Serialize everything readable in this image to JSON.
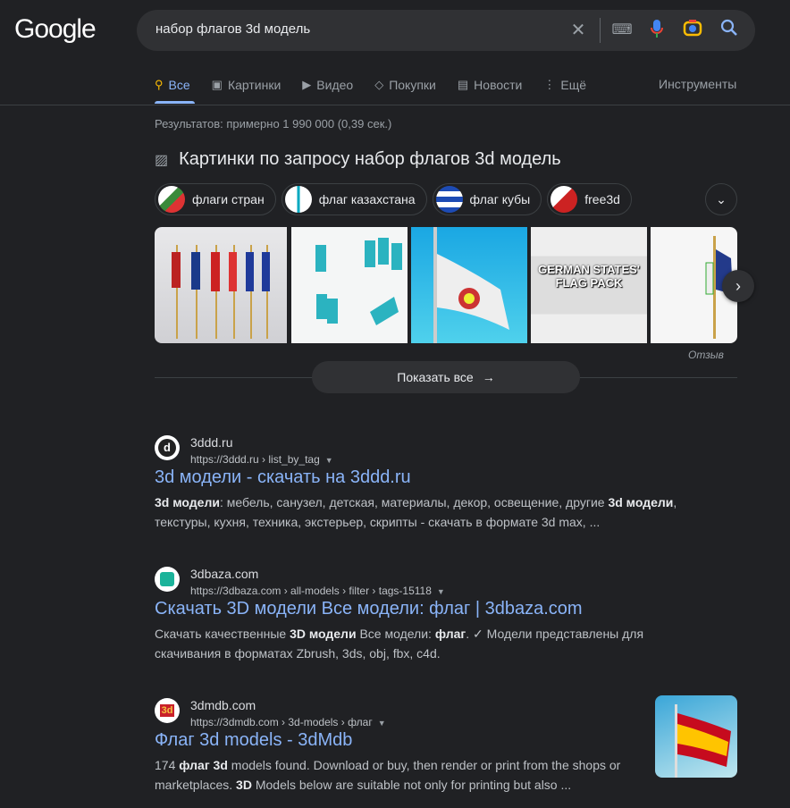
{
  "logo": "Google",
  "search": {
    "query": "набор флагов 3d модель"
  },
  "tabs": [
    {
      "label": "Все",
      "icon": "search-icon"
    },
    {
      "label": "Картинки",
      "icon": "image-icon"
    },
    {
      "label": "Видео",
      "icon": "play-icon"
    },
    {
      "label": "Покупки",
      "icon": "tag-icon"
    },
    {
      "label": "Новости",
      "icon": "news-icon"
    },
    {
      "label": "Ещё",
      "icon": "more-icon"
    }
  ],
  "tools_label": "Инструменты",
  "results_count": "Результатов: примерно 1 990 000 (0,39 сек.)",
  "images": {
    "heading": "Картинки по запросу набор флагов 3d модель",
    "chips": [
      "флаги стран",
      "флаг казахстана",
      "флаг кубы",
      "free3d"
    ],
    "pack_text": "GERMAN STATES' FLAG PACK",
    "feedback": "Отзыв",
    "show_all": "Показать все"
  },
  "results": [
    {
      "site": "3ddd.ru",
      "url": "https://3ddd.ru › list_by_tag",
      "title": "3d модели - скачать на 3ddd.ru",
      "snippet": [
        {
          "b": true,
          "t": "3d модели"
        },
        {
          "b": false,
          "t": ": мебель, санузел, детская, материалы, декор, освещение, другие "
        },
        {
          "b": true,
          "t": "3d модели"
        },
        {
          "b": false,
          "t": ", текстуры, кухня, техника, экстерьер, скрипты - скачать в формате 3d max, ..."
        }
      ]
    },
    {
      "site": "3dbaza.com",
      "url": "https://3dbaza.com › all-models › filter › tags-15118",
      "title": "Скачать 3D модели Все модели: флаг | 3dbaza.com",
      "snippet": [
        {
          "b": false,
          "t": "Скачать качественные "
        },
        {
          "b": true,
          "t": "3D модели"
        },
        {
          "b": false,
          "t": " Все модели: "
        },
        {
          "b": true,
          "t": "флаг"
        },
        {
          "b": false,
          "t": ". ✓ Модели представлены для скачивания в форматах Zbrush, 3ds, obj, fbx, c4d."
        }
      ]
    },
    {
      "site": "3dmdb.com",
      "url": "https://3dmdb.com › 3d-models › флаг",
      "title": "Флаг 3d models - 3dMdb",
      "snippet": [
        {
          "b": false,
          "t": "174 "
        },
        {
          "b": true,
          "t": "флаг 3d"
        },
        {
          "b": false,
          "t": " models found. Download or buy, then render or print from the shops or marketplaces. "
        },
        {
          "b": true,
          "t": "3D"
        },
        {
          "b": false,
          "t": " Models below are suitable not only for printing but also ..."
        }
      ]
    }
  ],
  "colors": {
    "bg": "#202124",
    "link": "#8ab4f8",
    "surface": "#303134"
  }
}
